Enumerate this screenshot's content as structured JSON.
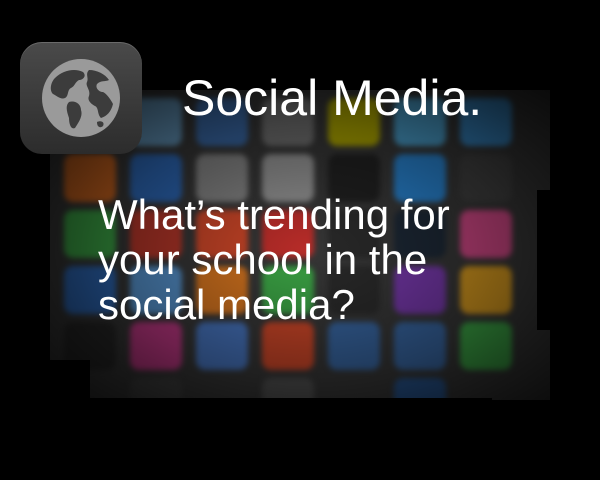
{
  "slide": {
    "title": "Social Media.",
    "question": "What’s trending for your school in the social media?"
  },
  "icons": {
    "app_icon": "globe-icon",
    "background": "social-media-icons-collage"
  },
  "colors": {
    "background": "#000000",
    "text": "#ffffff",
    "icon_tile": "#3a3a3a"
  }
}
